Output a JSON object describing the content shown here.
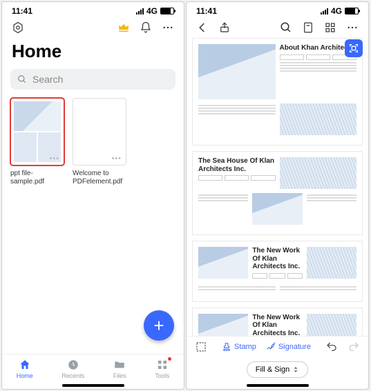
{
  "left": {
    "status": {
      "time": "11:41",
      "network": "4G"
    },
    "title": "Home",
    "search_placeholder": "Search",
    "files": [
      {
        "name": "ppt file-sample.pdf",
        "selected": true
      },
      {
        "name": "Welcome to PDFelement.pdf",
        "selected": false
      }
    ],
    "tabs": [
      {
        "label": "Home"
      },
      {
        "label": "Recents"
      },
      {
        "label": "Files"
      },
      {
        "label": "Tools"
      }
    ]
  },
  "right": {
    "status": {
      "time": "11:41",
      "network": "4G"
    },
    "doc": {
      "heading1": "About Khan Architects",
      "heading2": "The Sea House Of Klan Architects Inc.",
      "heading3": "The New Work Of Klan Architects Inc.",
      "heading4": "The New Work Of Klan Architects Inc."
    },
    "tools": {
      "stamp": "Stamp",
      "signature": "Signature",
      "mode": "Fill & Sign"
    }
  }
}
